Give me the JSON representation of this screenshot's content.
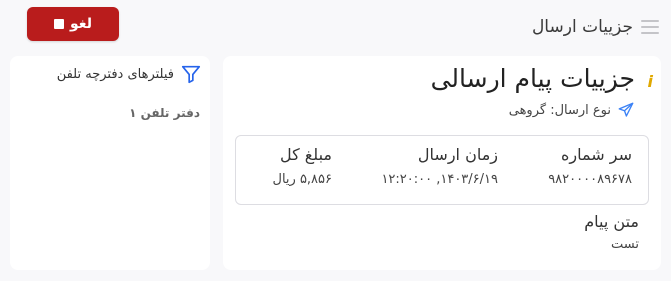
{
  "header": {
    "title": "جزییات ارسال",
    "cancel_label": "لغو"
  },
  "main": {
    "title": "جزییات پیام ارسالی",
    "send_type": "نوع ارسال: گروهی",
    "details": {
      "prefix_label": "سر شماره",
      "prefix_value": "۹۸۲۰۰۰۰۸۹۶۷۸",
      "time_label": "زمان ارسال",
      "time_value": "۱۴۰۳/۶/۱۹, ۱۲:۲۰:۰۰",
      "amount_label": "مبلغ کل",
      "amount_value": "۵,۸۵۶ ریال"
    },
    "text_label": "متن پیام",
    "text_value": "تست"
  },
  "sidebar": {
    "filter_title": "فیلترهای دفترچه تلفن",
    "items": [
      {
        "label": "دفتر تلفن ۱"
      }
    ]
  },
  "colors": {
    "cancel": "#b91c1c",
    "filter_icon": "#2563eb",
    "info_icon": "#e0a800"
  }
}
